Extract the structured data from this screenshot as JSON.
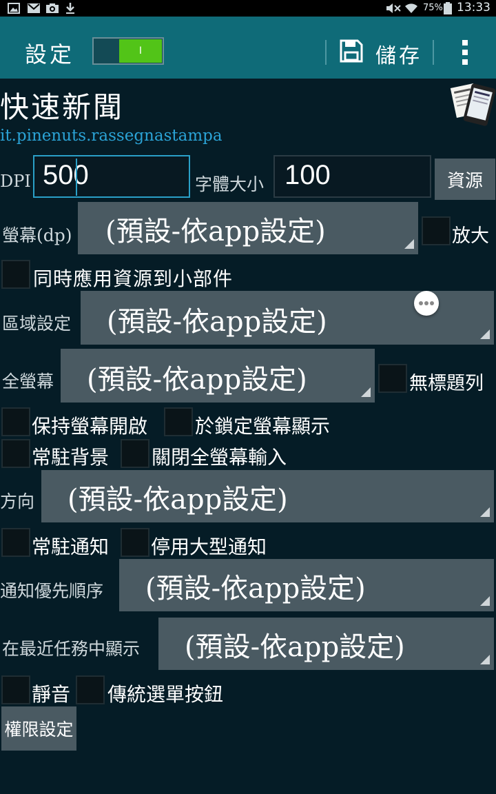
{
  "status_bar": {
    "battery": "75%",
    "time": "13:33"
  },
  "action_bar": {
    "title": "設定",
    "toggle_label": "I",
    "save_label": "儲存"
  },
  "app": {
    "name": "快速新聞",
    "package": "it.pinenuts.rassegnastampa"
  },
  "dpi": {
    "label": "DPI",
    "value": "500"
  },
  "font_size": {
    "label": "字體大小",
    "value": "100"
  },
  "resources_button": "資源",
  "screen": {
    "label": "螢幕(dp)",
    "value": "(預設-依app設定)",
    "zoom_label": "放大"
  },
  "apply_widgets_label": "同時應用資源到小部件",
  "locale": {
    "label": "區域設定",
    "value": "(預設-依app設定)"
  },
  "fullscreen": {
    "label": "全螢幕",
    "value": "(預設-依app設定)",
    "no_title_label": "無標題列"
  },
  "keep_screen_on_label": "保持螢幕開啟",
  "show_on_lockscreen_label": "於鎖定螢幕顯示",
  "persistent_background_label": "常駐背景",
  "close_fullscreen_input_label": "關閉全螢幕輸入",
  "orientation": {
    "label": "方向",
    "value": "(預設-依app設定)"
  },
  "persistent_notification_label": "常駐通知",
  "disable_big_notification_label": "停用大型通知",
  "notification_priority": {
    "label": "通知優先順序",
    "value": "(預設-依app設定)"
  },
  "recent_tasks": {
    "label": "在最近任務中顯示",
    "value": "(預設-依app設定)"
  },
  "mute_label": "靜音",
  "legacy_menu_button_label": "傳統選單按鈕",
  "permissions_button": "權限設定",
  "colors": {
    "action_bar": "#0f6b78",
    "background": "#051c26",
    "toggle_on": "#52c418",
    "package_link": "#2ba3d6",
    "input_focus": "#2aa0c8",
    "spinner": "#4a5a62"
  }
}
